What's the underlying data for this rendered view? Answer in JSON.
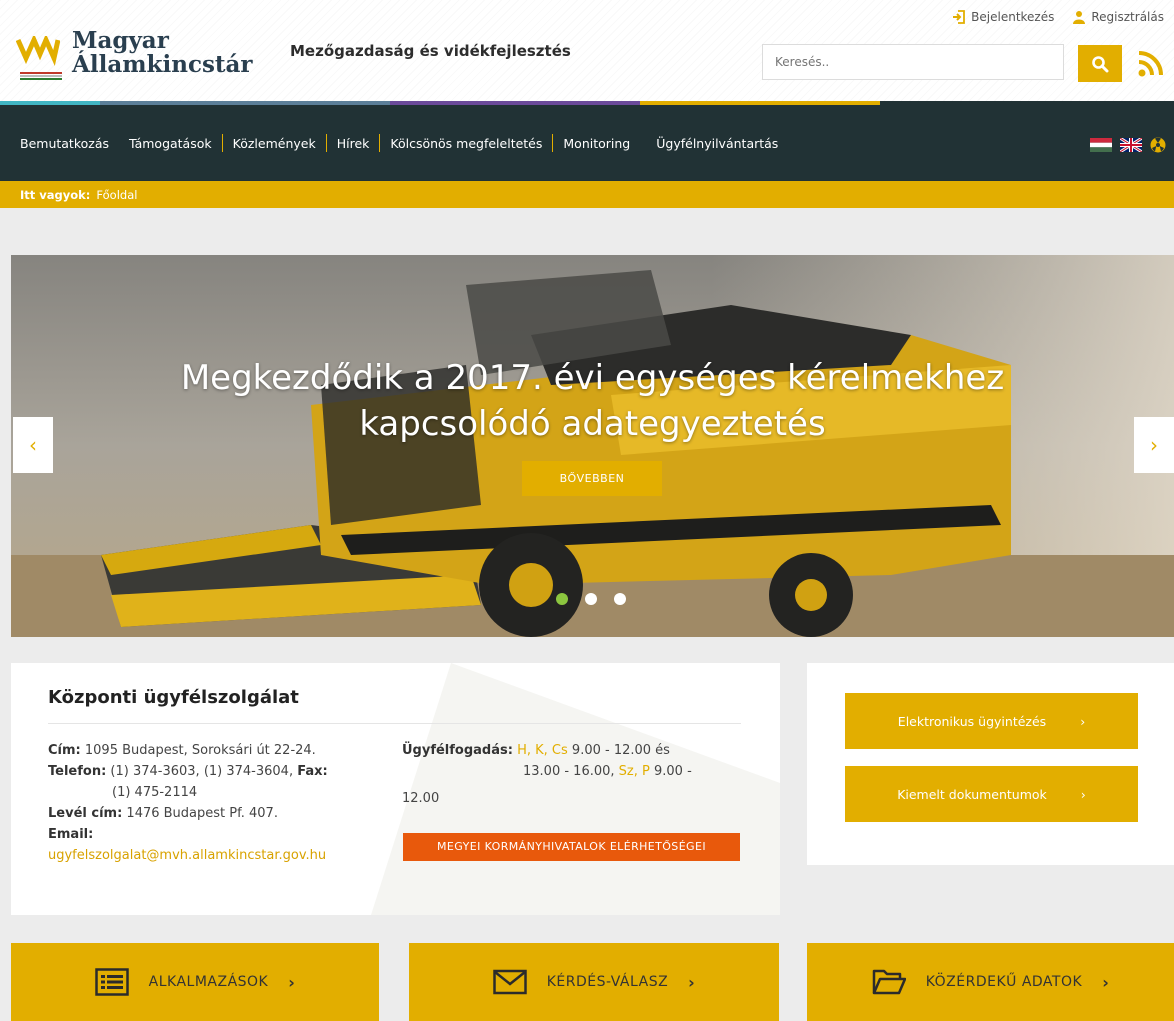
{
  "header": {
    "logo_line1": "Magyar",
    "logo_line2": "Államkincstár",
    "subtitle": "Mezőgazdaság és vidékfejlesztés",
    "login_label": "Bejelentkezés",
    "register_label": "Regisztrálás",
    "search_placeholder": "Keresés..",
    "icons": [
      "logo-icon",
      "login-icon",
      "user-icon",
      "search-icon",
      "rss-icon"
    ]
  },
  "nav": {
    "items": [
      {
        "label": "Bemutatkozás"
      },
      {
        "label": "Támogatások"
      },
      {
        "label": "Közlemények"
      },
      {
        "label": "Hírek"
      },
      {
        "label": "Kölcsönös megfeleltetés"
      },
      {
        "label": "Monitoring"
      },
      {
        "label": "Ügyfélnyilvántartás"
      }
    ],
    "flags": [
      "hungarian-flag-icon",
      "uk-flag-icon",
      "accessibility-icon"
    ]
  },
  "breadcrumb": {
    "label": "Itt vagyok:",
    "current": "Főoldal"
  },
  "hero": {
    "title_line1": "Megkezdődik a 2017. évi egységes kérelmekhez",
    "title_line2": "kapcsolódó adategyeztetés",
    "button_label": "BŐVEBBEN",
    "prev_label": "‹",
    "next_label": "›",
    "slide_count": 3,
    "active_slide": 1
  },
  "contact": {
    "title": "Központi ügyfélszolgálat",
    "address_label": "Cím:",
    "address_value": "1095 Budapest, Soroksári út 22-24.",
    "phone_label": "Telefon:",
    "phone_value": "(1) 374-3603, (1) 374-3604,",
    "fax_label": "Fax:",
    "fax_value": "(1) 475-2114",
    "mail_label": "Levél cím:",
    "mail_value": "1476 Budapest Pf. 407.",
    "email_label": "Email:",
    "email_value": "ugyfelszolgalat@mvh.allamkincstar.gov.hu",
    "hours_label": "Ügyfélfogadás:",
    "hours_days1": "H, K, Cs",
    "hours_time1": "9.00 - 12.00 és",
    "hours_time2": "13.00 - 16.00,",
    "hours_days2": "Sz, P",
    "hours_time3": "9.00 -",
    "hours_time4": "12.00",
    "county_button": "MEGYEI KORMÁNYHIVATALOK ELÉRHETŐSÉGEI"
  },
  "side": {
    "electronic": "Elektronikus ügyintézés",
    "documents": "Kiemelt dokumentumok",
    "chevron": "›"
  },
  "tiles": {
    "apps": "ALKALMAZÁSOK",
    "faq": "KÉRDÉS-VÁLASZ",
    "public": "KÖZÉRDEKŰ ADATOK",
    "chevron": "›"
  },
  "colors": {
    "accent": "#e2ae00",
    "nav_bg": "#213235",
    "orange": "#e8590c",
    "active_dot": "#8cc63f"
  }
}
